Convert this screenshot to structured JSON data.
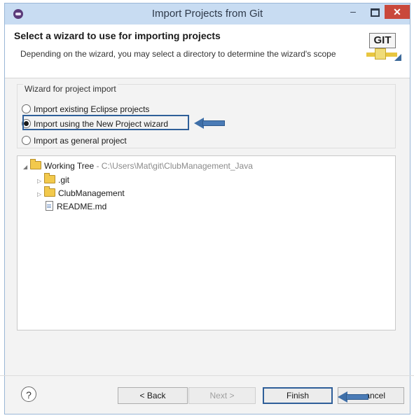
{
  "window": {
    "title": "Import Projects from Git",
    "minimize_label": "–",
    "close_label": "✕"
  },
  "header": {
    "title": "Select a wizard to use for importing projects",
    "description": "Depending on the wizard, you may select a directory to determine the wizard's scope",
    "logo_text": "GIT"
  },
  "wizard_group": {
    "label": "Wizard for project import",
    "options": [
      {
        "label": "Import existing Eclipse projects",
        "selected": false
      },
      {
        "label": "Import using the New Project wizard",
        "selected": true
      },
      {
        "label": "Import as general project",
        "selected": false
      }
    ]
  },
  "tree": {
    "root": {
      "label": "Working Tree",
      "path": " - C:\\Users\\Mat\\git\\ClubManagement_Java"
    },
    "children": [
      {
        "label": ".git",
        "type": "folder"
      },
      {
        "label": "ClubManagement",
        "type": "folder"
      },
      {
        "label": "README.md",
        "type": "file"
      }
    ]
  },
  "footer": {
    "help_label": "?",
    "back_label": "< Back",
    "next_label": "Next >",
    "finish_label": "Finish",
    "cancel_label": "ancel"
  },
  "colors": {
    "highlight_border": "#2f5f99",
    "arrow": "#4a7bb6",
    "close_button": "#c9483b",
    "titlebar": "#c8dcf2"
  }
}
